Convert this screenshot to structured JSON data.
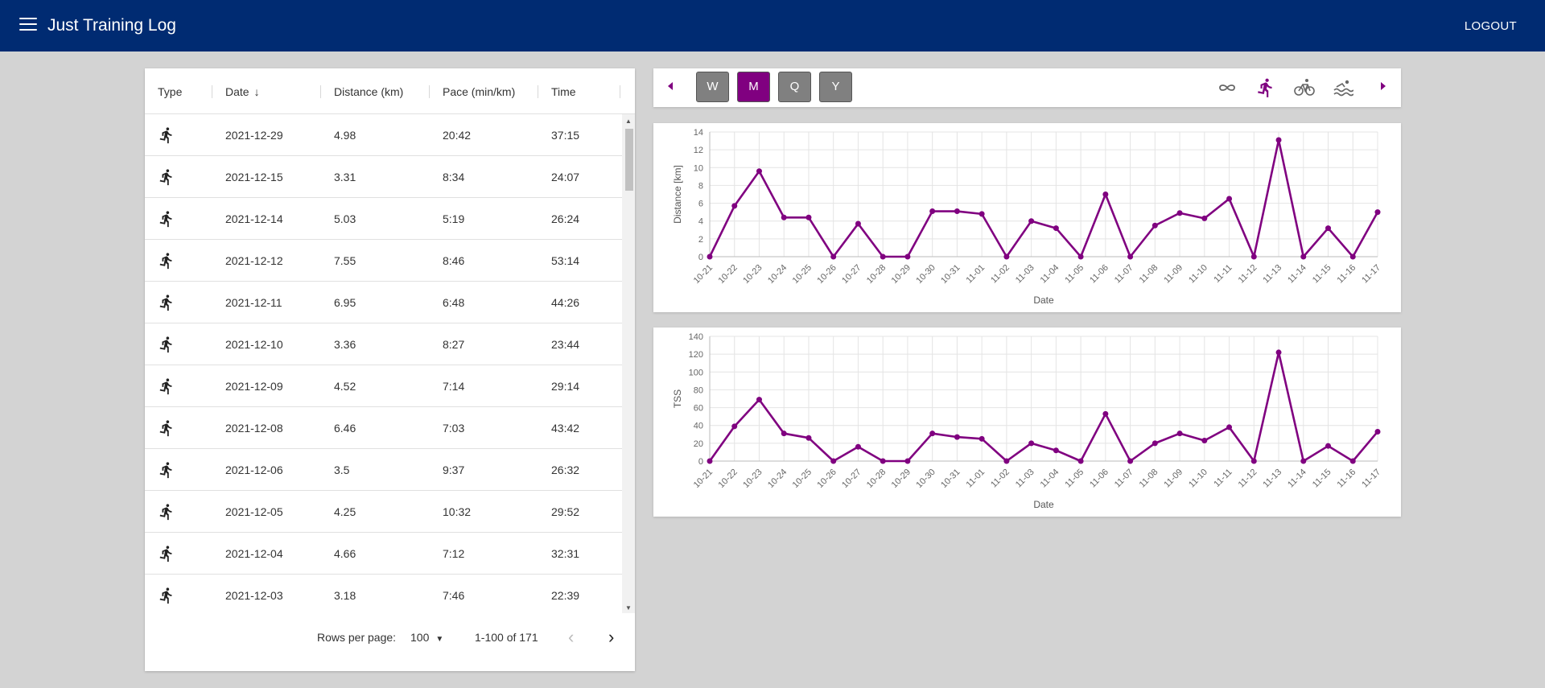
{
  "app": {
    "title": "Just Training Log",
    "logout_label": "LOGOUT"
  },
  "table": {
    "columns": [
      "Type",
      "Date",
      "Distance (km)",
      "Pace (min/km)",
      "Time"
    ],
    "rows": [
      {
        "type": "run-icon",
        "date": "2021-12-29",
        "distance": "4.98",
        "pace": "20:42",
        "time": "37:15"
      },
      {
        "type": "run-icon",
        "date": "2021-12-15",
        "distance": "3.31",
        "pace": "8:34",
        "time": "24:07"
      },
      {
        "type": "run-icon",
        "date": "2021-12-14",
        "distance": "5.03",
        "pace": "5:19",
        "time": "26:24"
      },
      {
        "type": "run-icon",
        "date": "2021-12-12",
        "distance": "7.55",
        "pace": "8:46",
        "time": "53:14"
      },
      {
        "type": "run-icon",
        "date": "2021-12-11",
        "distance": "6.95",
        "pace": "6:48",
        "time": "44:26"
      },
      {
        "type": "run-icon",
        "date": "2021-12-10",
        "distance": "3.36",
        "pace": "8:27",
        "time": "23:44"
      },
      {
        "type": "run-icon",
        "date": "2021-12-09",
        "distance": "4.52",
        "pace": "7:14",
        "time": "29:14"
      },
      {
        "type": "run-icon",
        "date": "2021-12-08",
        "distance": "6.46",
        "pace": "7:03",
        "time": "43:42"
      },
      {
        "type": "run-icon",
        "date": "2021-12-06",
        "distance": "3.5",
        "pace": "9:37",
        "time": "26:32"
      },
      {
        "type": "run-icon",
        "date": "2021-12-05",
        "distance": "4.25",
        "pace": "10:32",
        "time": "29:52"
      },
      {
        "type": "run-icon",
        "date": "2021-12-04",
        "distance": "4.66",
        "pace": "7:12",
        "time": "32:31"
      },
      {
        "type": "run-icon",
        "date": "2021-12-03",
        "distance": "3.18",
        "pace": "7:46",
        "time": "22:39"
      }
    ],
    "footer": {
      "rows_per_page_label": "Rows per page:",
      "rows_per_page_value": "100",
      "range": "1-100 of 171"
    }
  },
  "toolbar": {
    "periods": [
      "W",
      "M",
      "Q",
      "Y"
    ],
    "active_period": "M",
    "sport_icons": [
      "infinity-icon",
      "run-icon",
      "bike-icon",
      "swim-icon"
    ],
    "active_sport": "run-icon",
    "accent_color": "#800080",
    "inactive_color": "#808080"
  },
  "chart_data": [
    {
      "type": "line",
      "xlabel": "Date",
      "ylabel": "Distance [km]",
      "ylim": [
        0,
        14
      ],
      "yticks": [
        0,
        2,
        4,
        6,
        8,
        10,
        12,
        14
      ],
      "grid": true,
      "color": "#800080",
      "x": [
        "10-21",
        "10-22",
        "10-23",
        "10-24",
        "10-25",
        "10-26",
        "10-27",
        "10-28",
        "10-29",
        "10-30",
        "10-31",
        "11-01",
        "11-02",
        "11-03",
        "11-04",
        "11-05",
        "11-06",
        "11-07",
        "11-08",
        "11-09",
        "11-10",
        "11-11",
        "11-12",
        "11-13",
        "11-14",
        "11-15",
        "11-16",
        "11-17"
      ],
      "values": [
        0,
        5.7,
        9.6,
        4.4,
        4.4,
        0,
        3.7,
        0,
        0,
        5.1,
        5.1,
        4.8,
        0,
        4.0,
        3.2,
        0,
        7.0,
        0,
        3.5,
        4.9,
        4.3,
        6.5,
        0,
        13.1,
        0,
        3.2,
        0,
        5.0
      ]
    },
    {
      "type": "line",
      "xlabel": "Date",
      "ylabel": "TSS",
      "ylim": [
        0,
        140
      ],
      "yticks": [
        0,
        20,
        40,
        60,
        80,
        100,
        120,
        140
      ],
      "grid": true,
      "color": "#800080",
      "x": [
        "10-21",
        "10-22",
        "10-23",
        "10-24",
        "10-25",
        "10-26",
        "10-27",
        "10-28",
        "10-29",
        "10-30",
        "10-31",
        "11-01",
        "11-02",
        "11-03",
        "11-04",
        "11-05",
        "11-06",
        "11-07",
        "11-08",
        "11-09",
        "11-10",
        "11-11",
        "11-12",
        "11-13",
        "11-14",
        "11-15",
        "11-16",
        "11-17"
      ],
      "values": [
        0,
        39,
        69,
        31,
        26,
        0,
        16,
        0,
        0,
        31,
        27,
        25,
        0,
        20,
        12,
        0,
        53,
        0,
        20,
        31,
        23,
        38,
        0,
        122,
        0,
        17,
        0,
        33
      ]
    }
  ]
}
